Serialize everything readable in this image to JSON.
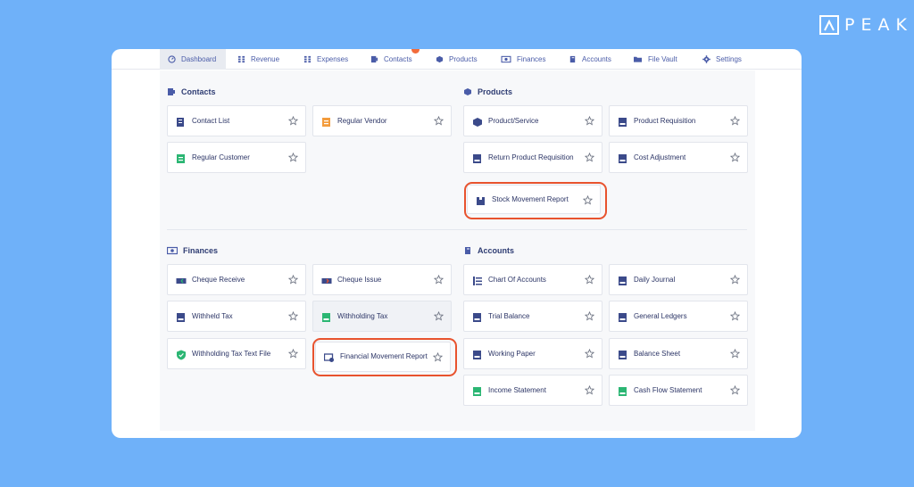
{
  "brand": {
    "name": "PEAK"
  },
  "nav": {
    "items": [
      {
        "label": "Dashboard",
        "icon": "dashboard-icon",
        "active": true
      },
      {
        "label": "Revenue",
        "icon": "revenue-icon"
      },
      {
        "label": "Expenses",
        "icon": "expenses-icon"
      },
      {
        "label": "Contacts",
        "icon": "contacts-icon"
      },
      {
        "label": "Products",
        "icon": "products-icon"
      },
      {
        "label": "Finances",
        "icon": "finances-icon"
      },
      {
        "label": "Accounts",
        "icon": "accounts-icon"
      },
      {
        "label": "File Vault",
        "icon": "folder-icon"
      },
      {
        "label": "Settings",
        "icon": "gear-icon"
      }
    ]
  },
  "sections": {
    "contacts": {
      "title": "Contacts",
      "cards": [
        "Contact List",
        "Regular Vendor",
        "Regular Customer"
      ]
    },
    "products": {
      "title": "Products",
      "cards": [
        "Product/Service",
        "Product Requisition",
        "Return Product Requisition",
        "Cost Adjustment",
        "Stock Movement Report"
      ]
    },
    "finances": {
      "title": "Finances",
      "cards": [
        "Cheque Receive",
        "Cheque Issue",
        "Withheld Tax",
        "Withholding Tax",
        "Withholding Tax Text File",
        "Financial Movement Report"
      ]
    },
    "accounts": {
      "title": "Accounts",
      "cards": [
        "Chart Of Accounts",
        "Daily Journal",
        "Trial Balance",
        "General Ledgers",
        "Working Paper",
        "Balance Sheet",
        "Income Statement",
        "Cash Flow Statement"
      ]
    }
  },
  "colors": {
    "background": "#6fb1f9",
    "nav_text": "#4a5ca8",
    "card_text": "#2c3566",
    "highlight_ring": "#e8532e",
    "icon_dark": "#3b4a8a",
    "icon_green": "#2bb673"
  }
}
